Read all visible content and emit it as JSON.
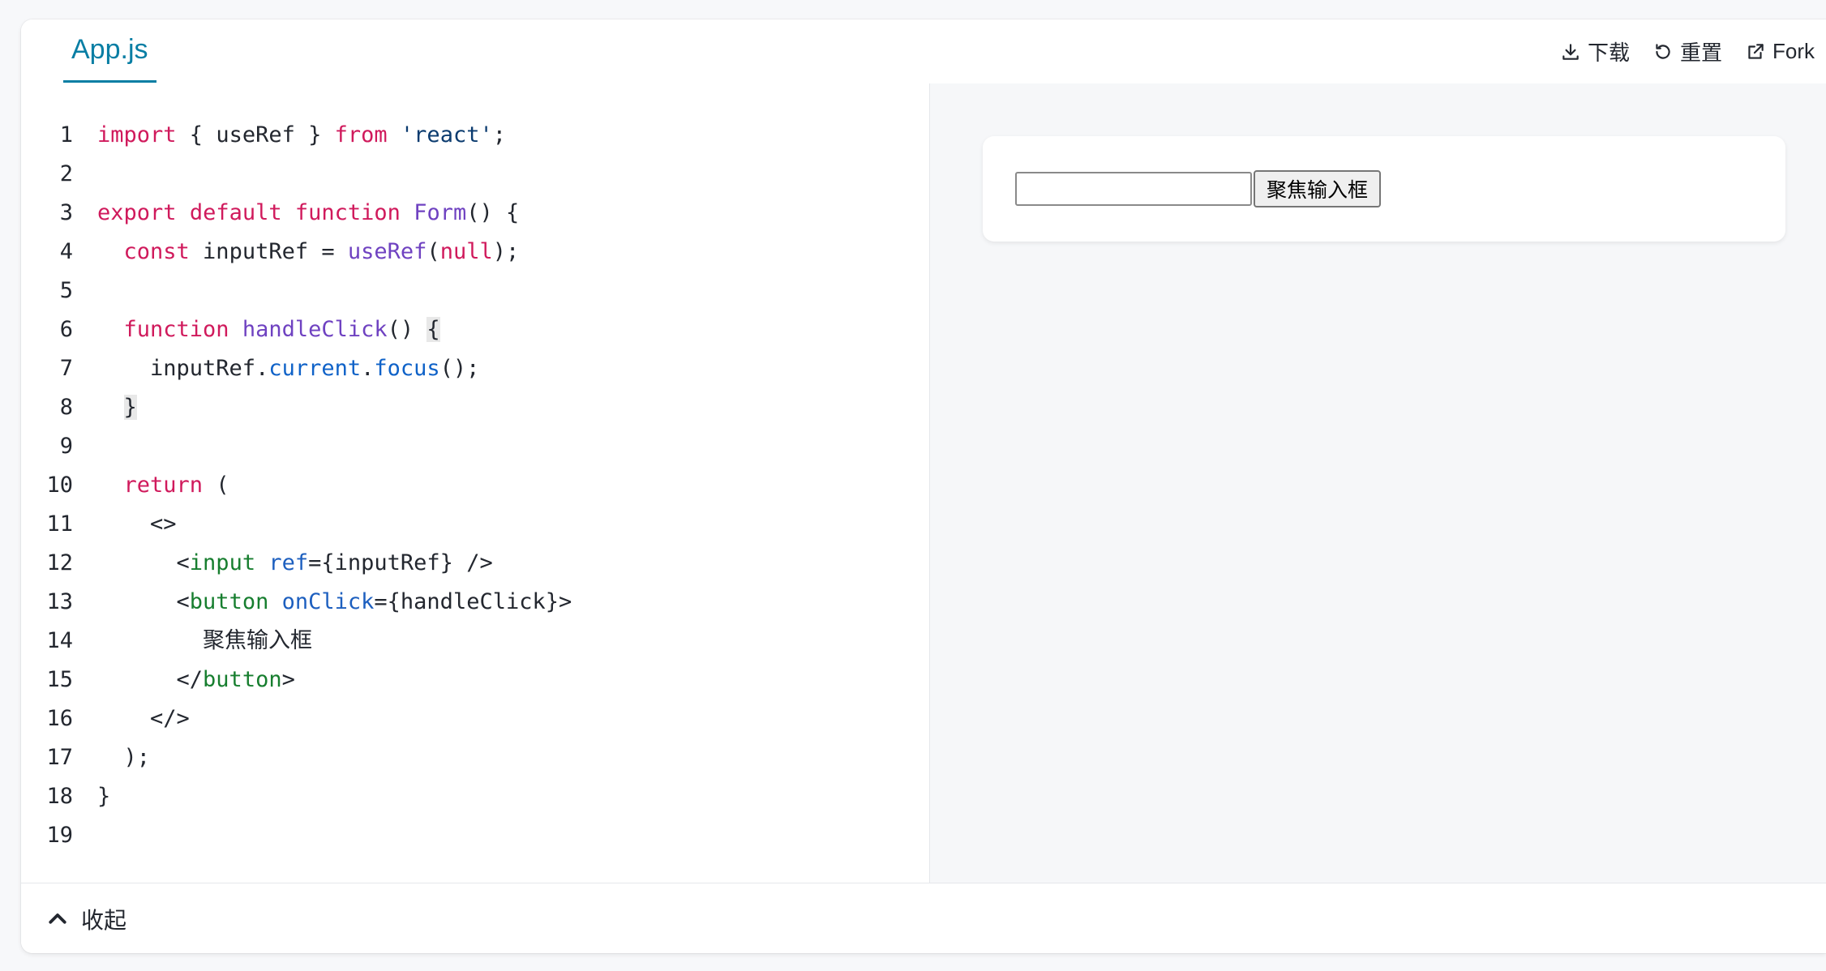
{
  "tab": {
    "label": "App.js"
  },
  "actions": {
    "download": "下载",
    "reset": "重置",
    "fork": "Fork"
  },
  "code_lines": [
    {
      "n": "1"
    },
    {
      "n": "2"
    },
    {
      "n": "3"
    },
    {
      "n": "4"
    },
    {
      "n": "5"
    },
    {
      "n": "6"
    },
    {
      "n": "7"
    },
    {
      "n": "8"
    },
    {
      "n": "9"
    },
    {
      "n": "10"
    },
    {
      "n": "11"
    },
    {
      "n": "12"
    },
    {
      "n": "13"
    },
    {
      "n": "14"
    },
    {
      "n": "15"
    },
    {
      "n": "16"
    },
    {
      "n": "17"
    },
    {
      "n": "18"
    },
    {
      "n": "19"
    }
  ],
  "code": {
    "l1": [
      "import",
      " { useRef } ",
      "from",
      " ",
      "'react'",
      ";"
    ],
    "l3": [
      "export",
      " ",
      "default",
      " ",
      "function",
      " ",
      "Form",
      "() {"
    ],
    "l4": [
      "  ",
      "const",
      " inputRef = ",
      "useRef",
      "(",
      "null",
      ");"
    ],
    "l6": [
      "  ",
      "function",
      " ",
      "handleClick",
      "() ",
      "{"
    ],
    "l7": [
      "    inputRef.",
      "current",
      ".",
      "focus",
      "();"
    ],
    "l8": [
      "  ",
      "}"
    ],
    "l10": [
      "  ",
      "return",
      " ("
    ],
    "l11": [
      "    <>"
    ],
    "l12": [
      "      <",
      "input",
      " ",
      "ref",
      "={inputRef} />"
    ],
    "l13": [
      "      <",
      "button",
      " ",
      "onClick",
      "={handleClick}>"
    ],
    "l14": [
      "        聚焦输入框"
    ],
    "l15": [
      "      </",
      "button",
      ">"
    ],
    "l16": [
      "    </>"
    ],
    "l17": [
      "  );"
    ],
    "l18": [
      "}"
    ]
  },
  "preview": {
    "input_value": "",
    "button_label": "聚焦输入框"
  },
  "footer": {
    "collapse_label": "收起"
  },
  "colors": {
    "accent": "#087ea4",
    "keyword": "#d01a5c",
    "function": "#6f42c1",
    "tag": "#177e2f",
    "attribute": "#1d5fbf"
  }
}
